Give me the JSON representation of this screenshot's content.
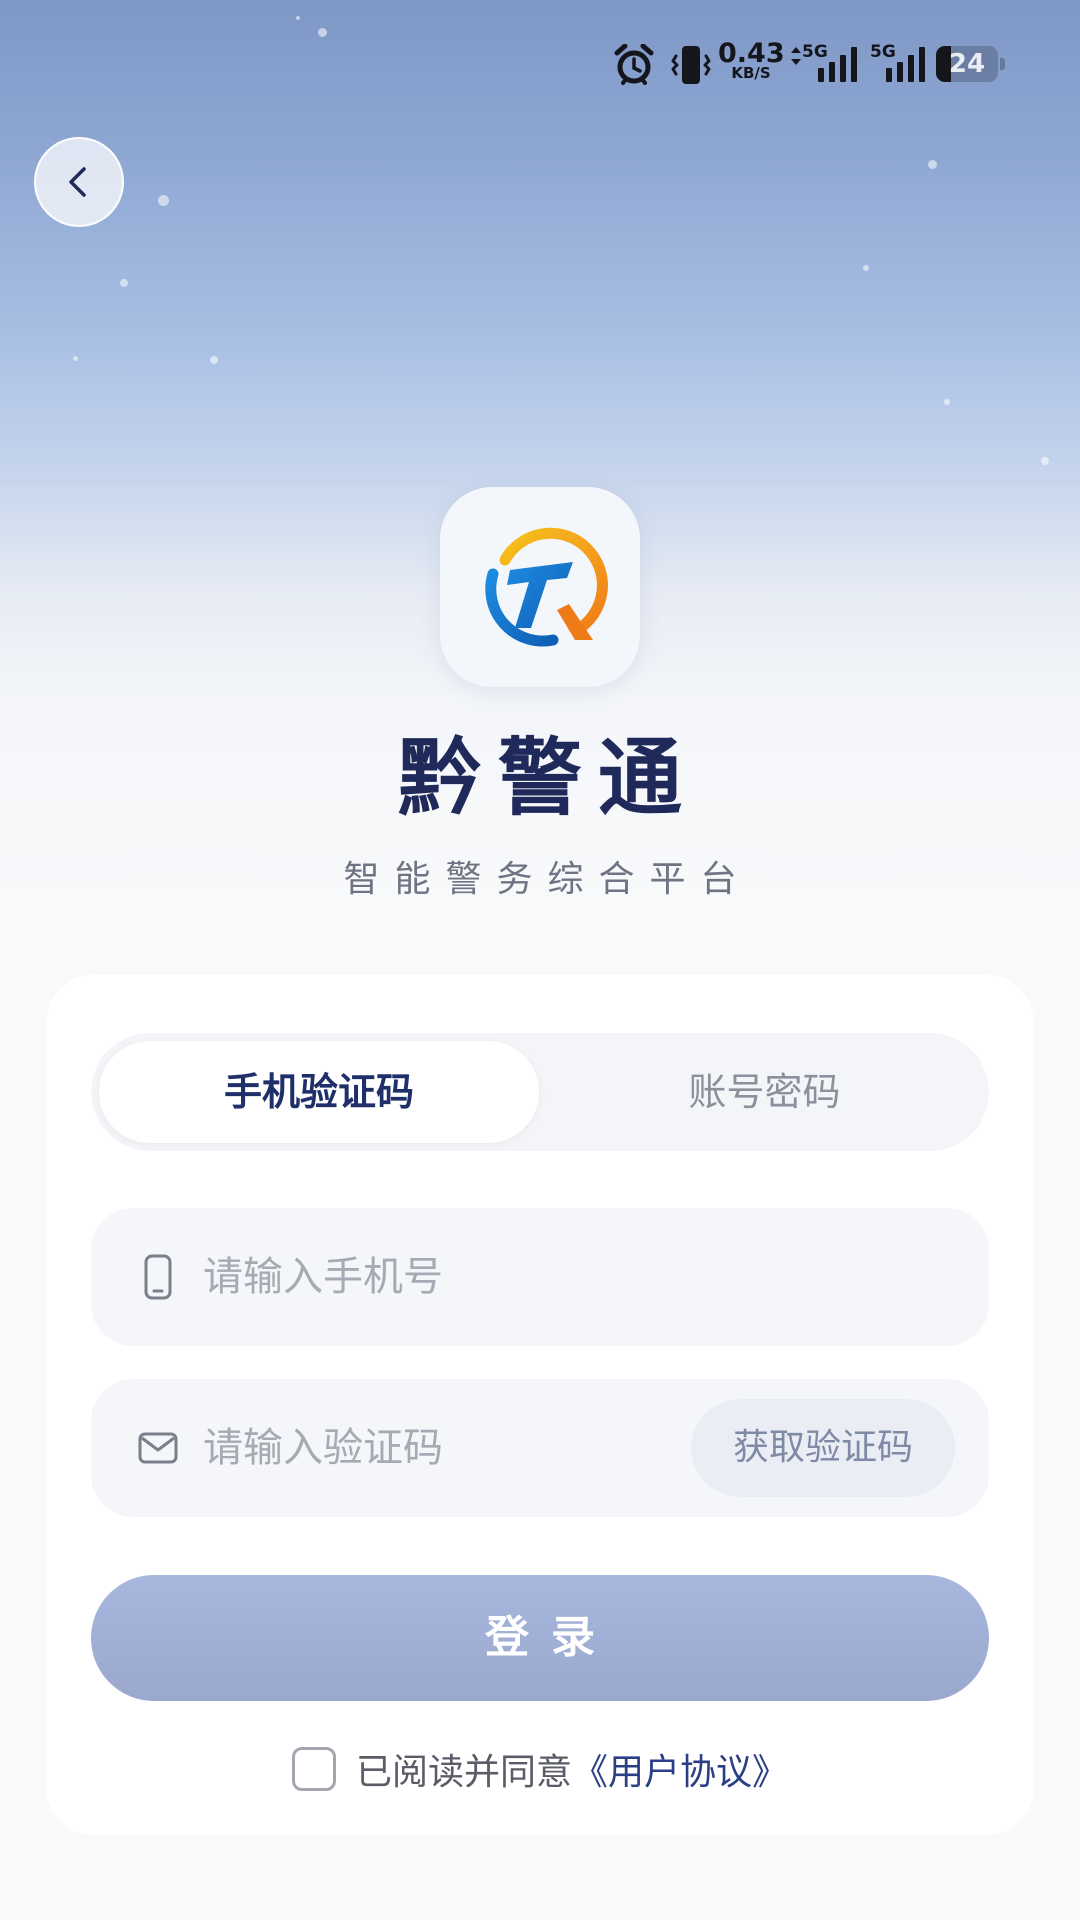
{
  "status_bar": {
    "net_speed_value": "0.43",
    "net_speed_unit": "KB/S",
    "signal1_label": "5G",
    "signal2_label": "5G",
    "battery_level": "24",
    "icons": [
      "alarm-icon",
      "vibrate-icon",
      "data-arrows-icon",
      "signal-icon",
      "signal-icon",
      "battery-icon"
    ]
  },
  "header": {
    "back_icon": "chevron-left-icon"
  },
  "app": {
    "title": "黔警通",
    "subtitle": "智能警务综合平台",
    "logo_icon": "tq-logo-icon"
  },
  "tabs": {
    "active_label": "手机验证码",
    "inactive_label": "账号密码"
  },
  "form": {
    "phone_placeholder": "请输入手机号",
    "phone_value": "",
    "phone_icon": "phone-icon",
    "code_placeholder": "请输入验证码",
    "code_value": "",
    "code_icon": "mail-icon",
    "get_code_label": "获取验证码"
  },
  "login_button": {
    "label": "登录"
  },
  "agreement": {
    "checked": false,
    "text": "已阅读并同意",
    "link_text": "《用户协议》"
  },
  "colors": {
    "primary_dark": "#1f2f6a",
    "login_button": "#a7b7de",
    "link": "#2b3f86",
    "placeholder": "#a7aab4"
  }
}
